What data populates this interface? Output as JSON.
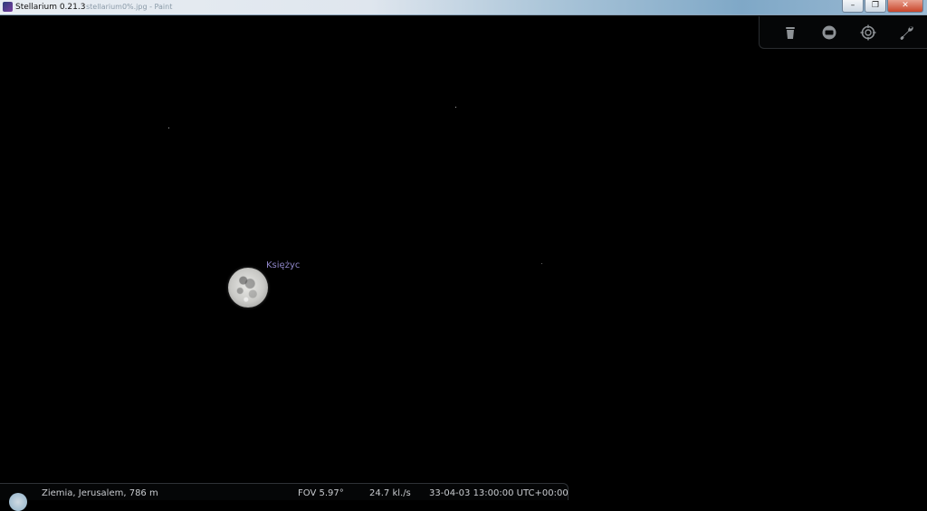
{
  "window": {
    "title": "Stellarium 0.21.3",
    "subtitle": "stellarium0%.jpg - Paint",
    "minimize_glyph": "–",
    "maximize_glyph": "❐",
    "close_glyph": "✕"
  },
  "toolbar": {
    "icons": [
      "trash-icon",
      "screen-icon",
      "target-icon",
      "wrench-icon"
    ]
  },
  "sky": {
    "object_label": "Księżyc"
  },
  "status": {
    "location": "Ziemia, Jerusalem, 786 m",
    "fov": "FOV 5.97°",
    "fps": "24.7 kl./s",
    "datetime": "33-04-03 13:00:00 UTC+00:00"
  },
  "colors": {
    "label": "#8f86c8",
    "status_text": "#c9ccd0",
    "sky": "#000000"
  }
}
